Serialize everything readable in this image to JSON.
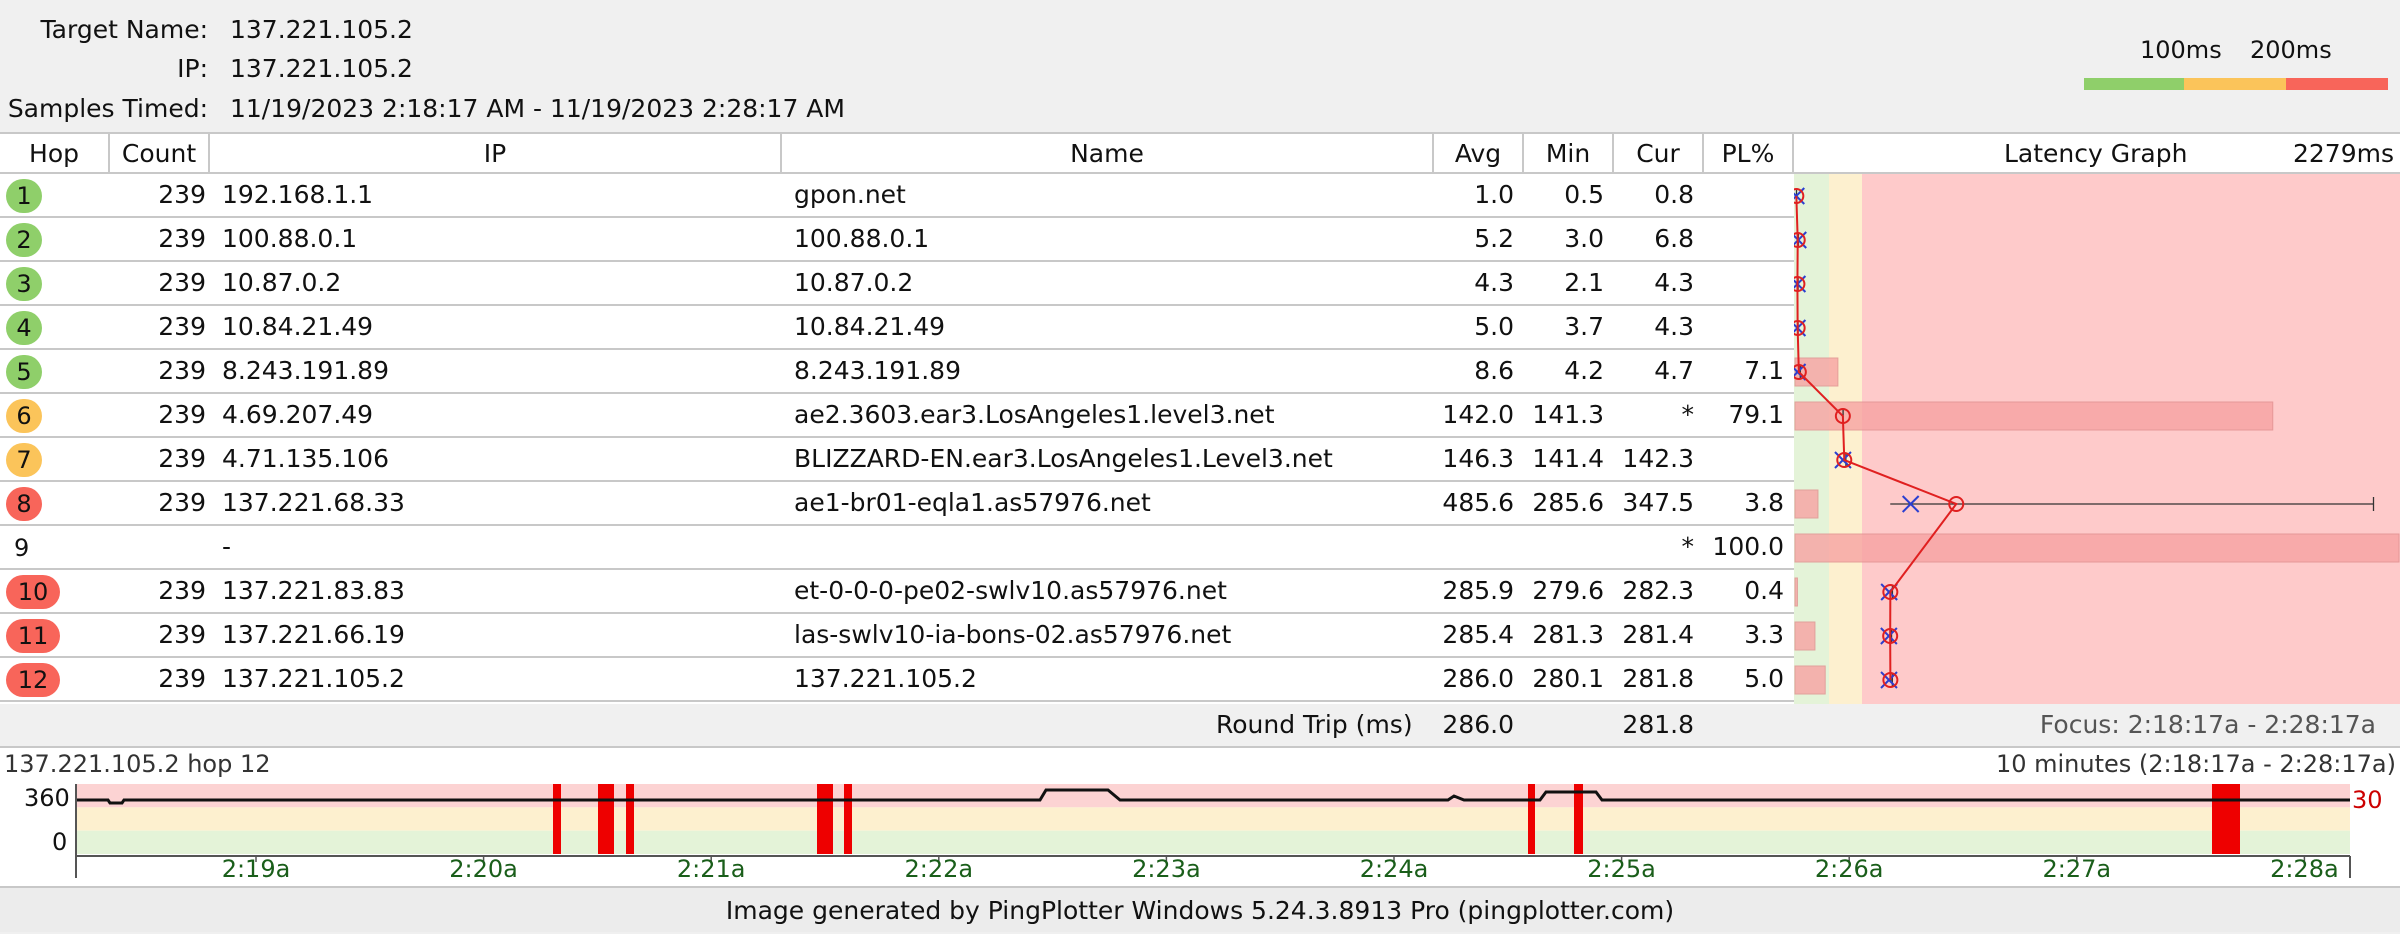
{
  "header": {
    "target_name_label": "Target Name:",
    "target_name": "137.221.105.2",
    "ip_label": "IP:",
    "ip": "137.221.105.2",
    "samples_label": "Samples Timed:",
    "samples": "11/19/2023 2:18:17 AM - 11/19/2023 2:28:17 AM"
  },
  "legend": {
    "label_100": "100ms",
    "label_200": "200ms",
    "colors": {
      "good": "#8fcf6a",
      "warn": "#fbc45a",
      "bad": "#f8655a"
    }
  },
  "table": {
    "columns": [
      "Hop",
      "Count",
      "IP",
      "Name",
      "Avg",
      "Min",
      "Cur",
      "PL%",
      "Latency Graph"
    ],
    "graph_max": "2279ms",
    "rows": [
      {
        "hop": "1",
        "count": "239",
        "ip": "192.168.1.1",
        "name": "gpon.net",
        "avg": "1.0",
        "min": "0.5",
        "cur": "0.8",
        "pl": "",
        "status": "good"
      },
      {
        "hop": "2",
        "count": "239",
        "ip": "100.88.0.1",
        "name": "100.88.0.1",
        "avg": "5.2",
        "min": "3.0",
        "cur": "6.8",
        "pl": "",
        "status": "good"
      },
      {
        "hop": "3",
        "count": "239",
        "ip": "10.87.0.2",
        "name": "10.87.0.2",
        "avg": "4.3",
        "min": "2.1",
        "cur": "4.3",
        "pl": "",
        "status": "good"
      },
      {
        "hop": "4",
        "count": "239",
        "ip": "10.84.21.49",
        "name": "10.84.21.49",
        "avg": "5.0",
        "min": "3.7",
        "cur": "4.3",
        "pl": "",
        "status": "good"
      },
      {
        "hop": "5",
        "count": "239",
        "ip": "8.243.191.89",
        "name": "8.243.191.89",
        "avg": "8.6",
        "min": "4.2",
        "cur": "4.7",
        "pl": "7.1",
        "status": "good"
      },
      {
        "hop": "6",
        "count": "239",
        "ip": "4.69.207.49",
        "name": "ae2.3603.ear3.LosAngeles1.level3.net",
        "avg": "142.0",
        "min": "141.3",
        "cur": "*",
        "pl": "79.1",
        "status": "warn"
      },
      {
        "hop": "7",
        "count": "239",
        "ip": "4.71.135.106",
        "name": "BLIZZARD-EN.ear3.LosAngeles1.Level3.net",
        "avg": "146.3",
        "min": "141.4",
        "cur": "142.3",
        "pl": "",
        "status": "warn"
      },
      {
        "hop": "8",
        "count": "239",
        "ip": "137.221.68.33",
        "name": "ae1-br01-eqla1.as57976.net",
        "avg": "485.6",
        "min": "285.6",
        "cur": "347.5",
        "pl": "3.8",
        "status": "bad"
      },
      {
        "hop": "9",
        "count": "",
        "ip": "-",
        "name": "",
        "avg": "",
        "min": "",
        "cur": "*",
        "pl": "100.0",
        "status": "none"
      },
      {
        "hop": "10",
        "count": "239",
        "ip": "137.221.83.83",
        "name": "et-0-0-0-pe02-swlv10.as57976.net",
        "avg": "285.9",
        "min": "279.6",
        "cur": "282.3",
        "pl": "0.4",
        "status": "bad"
      },
      {
        "hop": "11",
        "count": "239",
        "ip": "137.221.66.19",
        "name": "las-swlv10-ia-bons-02.as57976.net",
        "avg": "285.4",
        "min": "281.3",
        "cur": "281.4",
        "pl": "3.3",
        "status": "bad"
      },
      {
        "hop": "12",
        "count": "239",
        "ip": "137.221.105.2",
        "name": "137.221.105.2",
        "avg": "286.0",
        "min": "280.1",
        "cur": "281.8",
        "pl": "5.0",
        "status": "bad"
      }
    ]
  },
  "round_trip": {
    "label": "Round Trip (ms)",
    "avg": "286.0",
    "cur": "281.8",
    "focus": "Focus: 2:18:17a - 2:28:17a"
  },
  "history": {
    "title": "137.221.105.2 hop 12",
    "range": "10 minutes (2:18:17a - 2:28:17a)",
    "y_top": "360",
    "y_bottom": "0",
    "right_label": "30",
    "ticks": [
      "2:19a",
      "2:20a",
      "2:21a",
      "2:22a",
      "2:23a",
      "2:24a",
      "2:25a",
      "2:26a",
      "2:27a",
      "2:28a"
    ]
  },
  "footer": {
    "text": "Image generated by PingPlotter Windows 5.24.3.8913 Pro (pingplotter.com)"
  }
}
